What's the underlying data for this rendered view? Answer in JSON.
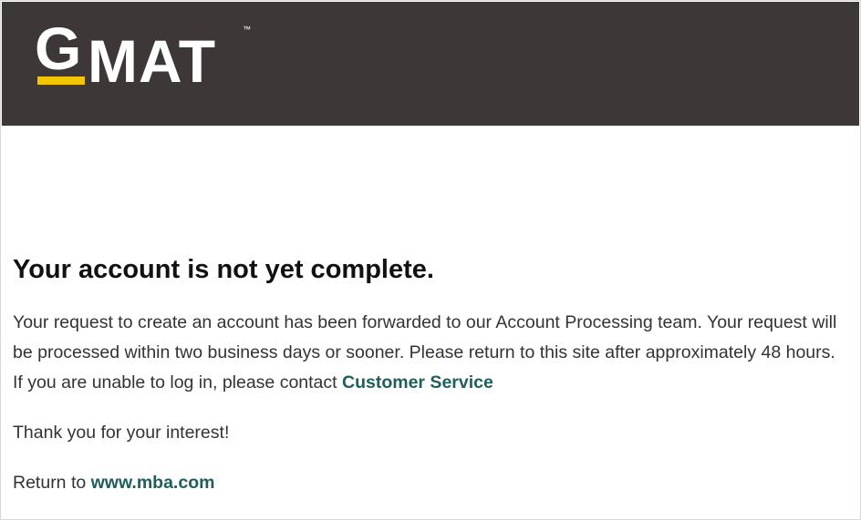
{
  "header": {
    "logo": {
      "letter_g": "G",
      "letters_mat": "MAT",
      "trademark": "™"
    },
    "background_color": "#3d3837",
    "accent_color": "#f2c500"
  },
  "main": {
    "title": "Your account is not yet complete.",
    "paragraph1": {
      "text": "Your request to create an account has been forwarded to our Account Processing team. Your request will be processed within two business days or sooner. Please return to this site after approximately 48 hours. If you are unable to log in, please contact ",
      "link_label": "Customer Service"
    },
    "thanks": "Thank you for your interest!",
    "return": {
      "prefix": "Return to ",
      "link_label": "www.mba.com"
    },
    "link_color": "#1f5f5b"
  }
}
